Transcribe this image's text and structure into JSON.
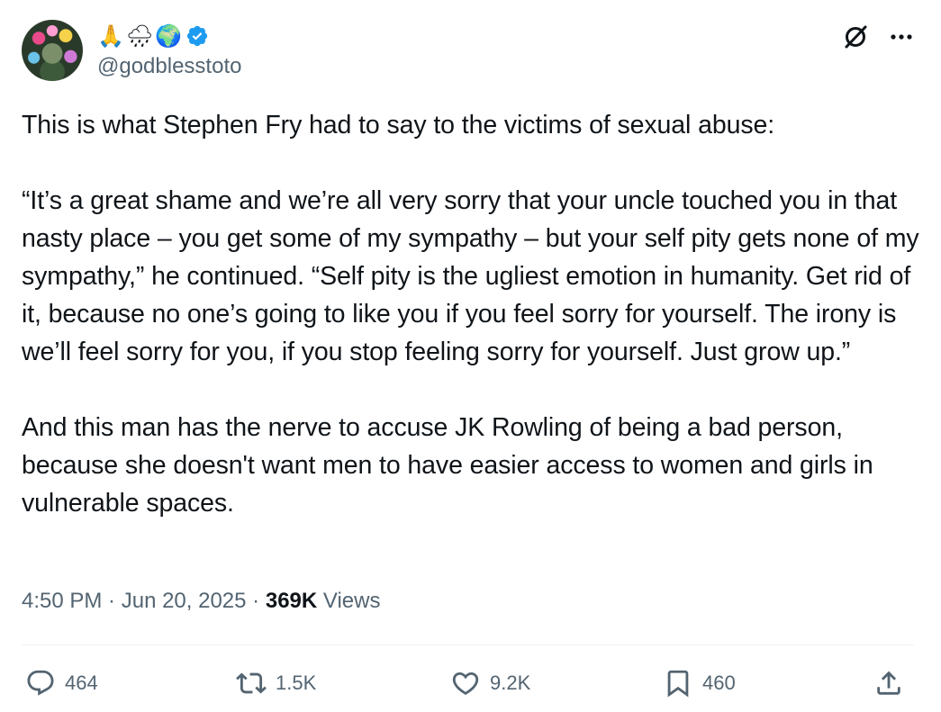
{
  "user": {
    "display_name_emojis": [
      "🙏",
      "🌧",
      "🌍"
    ],
    "handle": "@godblesstoto",
    "verified": true
  },
  "icons": {
    "verified": "verified-badge-icon",
    "grok": "grok-icon",
    "more": "more-icon",
    "reply": "reply-icon",
    "retweet": "retweet-icon",
    "like": "like-icon",
    "bookmark": "bookmark-icon",
    "share": "share-icon"
  },
  "tweet": {
    "text": "This is what Stephen Fry had to say to the victims of sexual abuse:\n\n“It’s a great shame and we’re all very sorry that your uncle touched you in that nasty place – you get some of my sympathy – but your self pity gets none of my sympathy,” he continued. “Self pity is the ugliest emotion in humanity. Get rid of it, because no one’s going to like you if you feel sorry for yourself. The irony is we’ll feel sorry for you, if you stop feeling sorry for yourself. Just grow up.”\n\nAnd this man has the nerve to accuse JK Rowling of being a bad person, because she doesn't want men to have easier access to women and girls in vulnerable spaces."
  },
  "meta": {
    "time": "4:50 PM",
    "sep1": " · ",
    "date": "Jun 20, 2025",
    "sep2": " · ",
    "views_count": "369K",
    "views_label": " Views"
  },
  "actions": {
    "replies": "464",
    "retweets": "1.5K",
    "likes": "9.2K",
    "bookmarks": "460"
  },
  "colors": {
    "verified_blue": "#1d9bf0",
    "secondary_text": "#536471",
    "primary_text": "#0f1419",
    "divider": "#eff3f4"
  }
}
